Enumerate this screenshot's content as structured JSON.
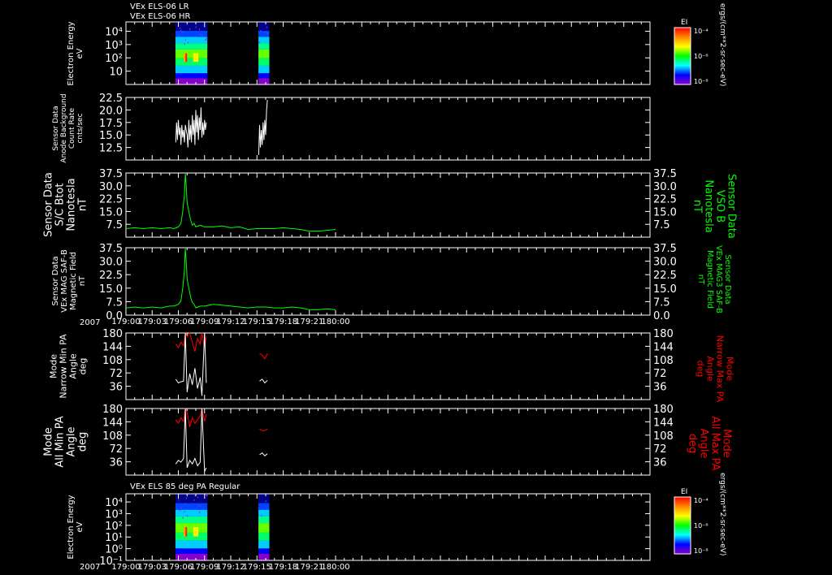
{
  "header": {
    "line1": "VEx ELS-06 LR",
    "line2": "VEx ELS-06 HR"
  },
  "panel7_title": "VEx ELS 85 deg PA Regular",
  "year": "2007",
  "time_ticks": [
    "179:00",
    "179:03",
    "179:06",
    "179:09",
    "179:12",
    "179:15",
    "179:18",
    "179:21",
    "180:00"
  ],
  "colorbar": {
    "label": "EI",
    "ticks": [
      "10⁻⁴",
      "10⁻⁶",
      "10⁻⁸"
    ],
    "units": "ergs/(cm**2-sr-sec-eV)",
    "colors": [
      "#ff0000",
      "#ff8800",
      "#ffff00",
      "#00ff00",
      "#00ffff",
      "#0000ff",
      "#8800cc"
    ]
  },
  "colors": {
    "green": "#00ff00",
    "red": "#ff0000",
    "white": "#ffffff"
  },
  "chart_data": [
    {
      "type": "heatmap",
      "id": "spec1",
      "ylabel": [
        "Electron Energy",
        "eV"
      ],
      "yticks": [
        "10",
        "10²",
        "10³",
        "10⁴"
      ],
      "x_data_ranges": [
        [
          "179:05:40",
          "179:09:15"
        ],
        [
          "179:15:10",
          "179:16:20"
        ]
      ]
    },
    {
      "type": "line",
      "id": "anode",
      "ylabel": [
        "Sensor Data",
        "Anode Background",
        "Count Rate",
        "cnts/sec"
      ],
      "ylim": [
        10,
        22.5
      ],
      "yticks": [
        "12.5",
        "15.0",
        "17.5",
        "20.0",
        "22.5"
      ],
      "series": [
        {
          "color": "#ffffff",
          "x": [
            5.7,
            5.8,
            5.9,
            6.0,
            6.1,
            6.2,
            6.3,
            6.4,
            6.5,
            6.6,
            6.7,
            6.8,
            6.9,
            7.0,
            7.1,
            7.2,
            7.3,
            7.4,
            7.5,
            7.6,
            7.7,
            7.8,
            7.9,
            8.0,
            8.1,
            8.2,
            8.3,
            8.4,
            8.5,
            8.6,
            8.7,
            8.8,
            8.9,
            9.0,
            9.1,
            9.2
          ],
          "values": [
            13.5,
            17.5,
            14,
            18,
            15,
            16.5,
            13,
            17,
            14.5,
            16,
            13.5,
            17,
            16,
            15,
            12.5,
            18,
            14,
            17,
            13.5,
            19,
            15,
            18,
            13,
            20,
            15.5,
            19,
            14,
            18.5,
            16,
            20.5,
            14.5,
            17.5,
            15,
            18,
            16,
            17.5
          ]
        },
        {
          "color": "#ffffff",
          "x": [
            15.2,
            15.3,
            15.4,
            15.5,
            15.6,
            15.7,
            15.8,
            15.9,
            16.0,
            16.1,
            16.2
          ],
          "values": [
            11,
            17,
            12.5,
            16,
            13,
            17.5,
            14,
            18,
            15,
            20,
            22
          ]
        }
      ]
    },
    {
      "type": "line",
      "id": "scb",
      "ylabel": [
        "Sensor Data",
        "S/C Btot",
        "Nanotesla",
        "nT"
      ],
      "ylabel_right": [
        "Sensor Data",
        "VSO B",
        "Nanotesla",
        "nT"
      ],
      "ylim": [
        0,
        37.5
      ],
      "yticks": [
        "7.5",
        "15.0",
        "22.5",
        "30.0",
        "37.5"
      ],
      "series": [
        {
          "color": "#00ff00",
          "x": [
            0,
            1,
            2,
            3,
            4,
            5,
            5.5,
            6.0,
            6.3,
            6.5,
            6.7,
            6.8,
            6.9,
            7.0,
            7.2,
            7.4,
            7.6,
            7.8,
            8.0,
            8.5,
            9.0,
            10,
            11,
            12,
            13,
            14,
            15,
            16,
            17,
            18,
            19,
            20,
            21,
            22,
            23,
            24
          ],
          "values": [
            5,
            5.5,
            5,
            5.5,
            5,
            5.5,
            5,
            6,
            8,
            15,
            25,
            37,
            30,
            20,
            15,
            10,
            7,
            8,
            6,
            7,
            6,
            6,
            6.5,
            5.5,
            6,
            4.5,
            5,
            5,
            5,
            5.5,
            5,
            4.5,
            3.5,
            3.5,
            4,
            4.5
          ]
        }
      ]
    },
    {
      "type": "line",
      "id": "mag",
      "ylabel": [
        "Sensor Data",
        "VEx MAG SAF-B",
        "Magnetic Field",
        "nT"
      ],
      "ylabel_right": [
        "Sensor Data",
        "VEx MAG3 SAF-B",
        "Magnetic Field",
        "nT"
      ],
      "ylim": [
        0,
        37.5
      ],
      "yticks": [
        "0.0",
        "7.5",
        "15.0",
        "22.5",
        "30.0",
        "37.5"
      ],
      "series": [
        {
          "color": "#00ff00",
          "x": [
            0,
            1,
            2,
            3,
            4,
            5,
            5.5,
            6.0,
            6.3,
            6.5,
            6.7,
            6.8,
            6.9,
            7.0,
            7.2,
            7.4,
            7.6,
            7.8,
            8.0,
            8.5,
            9.0,
            10,
            11,
            12,
            13,
            14,
            15,
            16,
            17,
            18,
            19,
            20,
            21,
            22,
            23,
            24
          ],
          "values": [
            4,
            4.5,
            4,
            4.5,
            4,
            5,
            5,
            6,
            8,
            15,
            25,
            37,
            30,
            20,
            15,
            10,
            7,
            6,
            4,
            5,
            5,
            6,
            5.5,
            5,
            4.5,
            4,
            4.5,
            4.5,
            4,
            4,
            4.5,
            4,
            3,
            3,
            3.5,
            3
          ]
        }
      ]
    },
    {
      "type": "line",
      "id": "narrowpa",
      "ylabel": [
        "Mode",
        "Narrow Min PA",
        "Angle",
        "deg"
      ],
      "ylabel_right": [
        "Mode",
        "Narrow Max PA",
        "Angle",
        "deg"
      ],
      "ylim": [
        0,
        180
      ],
      "yticks": [
        "36",
        "72",
        "108",
        "144",
        "180"
      ],
      "series": [
        {
          "color": "#ff0000",
          "x": [
            5.7,
            6.0,
            6.3,
            6.6,
            6.8,
            7.0,
            7.3,
            7.6,
            7.9,
            8.2,
            8.5,
            8.7,
            9.0,
            9.2
          ],
          "values": [
            150,
            140,
            155,
            145,
            180,
            170,
            180,
            155,
            130,
            165,
            150,
            180,
            140,
            170
          ]
        },
        {
          "color": "#ffffff",
          "x": [
            5.7,
            6.0,
            6.3,
            6.6,
            6.8,
            7.0,
            7.3,
            7.6,
            7.9,
            8.2,
            8.5,
            8.7,
            9.0,
            9.2
          ],
          "values": [
            55,
            45,
            48,
            50,
            180,
            20,
            70,
            40,
            85,
            30,
            60,
            10,
            180,
            45
          ]
        },
        {
          "color": "#ff0000",
          "x": [
            15.3,
            15.6,
            15.9,
            16.2
          ],
          "values": [
            125,
            120,
            110,
            125
          ]
        },
        {
          "color": "#ffffff",
          "x": [
            15.3,
            15.6,
            15.9,
            16.2
          ],
          "values": [
            50,
            55,
            45,
            52
          ]
        }
      ]
    },
    {
      "type": "line",
      "id": "allpa",
      "ylabel": [
        "Mode",
        "All Min PA",
        "Angle",
        "deg"
      ],
      "ylabel_right": [
        "Mode",
        "All Max PA",
        "Angle",
        "deg"
      ],
      "ylim": [
        0,
        180
      ],
      "yticks": [
        "36",
        "72",
        "108",
        "144",
        "180"
      ],
      "series": [
        {
          "color": "#ff0000",
          "x": [
            5.7,
            6.0,
            6.3,
            6.6,
            6.8,
            7.0,
            7.3,
            7.6,
            7.9,
            8.2,
            8.5,
            8.7,
            9.0,
            9.2
          ],
          "values": [
            150,
            140,
            155,
            145,
            180,
            170,
            130,
            155,
            140,
            150,
            160,
            180,
            145,
            165
          ]
        },
        {
          "color": "#ffffff",
          "x": [
            5.7,
            6.0,
            6.3,
            6.6,
            6.8,
            7.0,
            7.3,
            7.6,
            7.9,
            8.2,
            8.5,
            8.7,
            9.0,
            9.2
          ],
          "values": [
            30,
            40,
            35,
            45,
            180,
            20,
            40,
            30,
            45,
            25,
            35,
            180,
            10,
            20
          ]
        },
        {
          "color": "#ff0000",
          "x": [
            15.3,
            15.6,
            15.9,
            16.2
          ],
          "values": [
            125,
            120,
            120,
            125
          ]
        },
        {
          "color": "#ffffff",
          "x": [
            15.3,
            15.6,
            15.9,
            16.2
          ],
          "values": [
            55,
            60,
            52,
            58
          ]
        }
      ]
    },
    {
      "type": "heatmap",
      "id": "spec2",
      "ylabel": [
        "Electron Energy",
        "eV"
      ],
      "yticks": [
        "10⁻¹",
        "10⁰",
        "10¹",
        "10²",
        "10³",
        "10⁴"
      ],
      "x_data_ranges": [
        [
          "179:05:40",
          "179:09:15"
        ],
        [
          "179:15:10",
          "179:16:20"
        ]
      ]
    }
  ]
}
